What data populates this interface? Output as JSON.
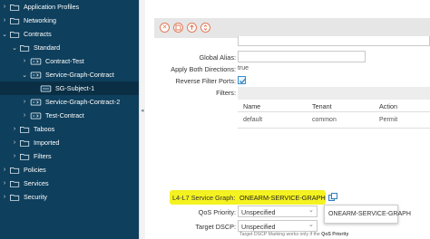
{
  "sidebar": {
    "items": [
      {
        "label": "Application Profiles",
        "type": "folder",
        "level": 0,
        "expanded": false
      },
      {
        "label": "Networking",
        "type": "folder",
        "level": 0,
        "expanded": false
      },
      {
        "label": "Contracts",
        "type": "folder",
        "level": 0,
        "expanded": true
      },
      {
        "label": "Standard",
        "type": "folder",
        "level": 1,
        "expanded": true
      },
      {
        "label": "Contract-Test",
        "type": "contract",
        "level": 2,
        "expanded": false
      },
      {
        "label": "Service-Graph-Contract",
        "type": "contract",
        "level": 2,
        "expanded": true
      },
      {
        "label": "SG-Subject-1",
        "type": "subject",
        "level": 3,
        "selected": true
      },
      {
        "label": "Service-Graph-Contract-2",
        "type": "contract",
        "level": 2,
        "expanded": false
      },
      {
        "label": "Test-Contract",
        "type": "contract",
        "level": 2,
        "expanded": false
      },
      {
        "label": "Taboos",
        "type": "folder",
        "level": 1,
        "expanded": false
      },
      {
        "label": "Imported",
        "type": "folder",
        "level": 1,
        "expanded": false
      },
      {
        "label": "Filters",
        "type": "folder",
        "level": 1,
        "expanded": false
      },
      {
        "label": "Policies",
        "type": "folder",
        "level": 0,
        "expanded": false
      },
      {
        "label": "Services",
        "type": "folder",
        "level": 0,
        "expanded": false
      },
      {
        "label": "Security",
        "type": "folder",
        "level": 0,
        "expanded": false
      }
    ]
  },
  "toolbar": {
    "icons": [
      "delete-icon",
      "save-icon",
      "upload-icon",
      "add-icon"
    ]
  },
  "form": {
    "global_alias_label": "Global Alias:",
    "global_alias_value": "",
    "apply_both_label": "Apply Both Directions:",
    "apply_both_value": "true",
    "reverse_filter_label": "Reverse Filter Ports:",
    "reverse_filter_checked": true,
    "filters_label": "Filters:"
  },
  "filters_table": {
    "columns": [
      "Name",
      "Tenant",
      "Action"
    ],
    "rows": [
      {
        "name": "default",
        "tenant": "common",
        "action": "Permit"
      }
    ]
  },
  "service_graph": {
    "label": "L4-L7 Service Graph:",
    "value": "ONEARM-SERVICE-GRAPH"
  },
  "qos": {
    "label": "QoS Priority:",
    "value": "Unspecified"
  },
  "dropdown": {
    "option": "ONEARM-SERVICE-GRAPH"
  },
  "target_dscp": {
    "label": "Target DSCP:",
    "value": "Unspecified",
    "help_prefix": "Target DSCP Marking works only if the",
    "help_bold": "QoS Priority"
  },
  "colors": {
    "sidebar_bg": "#0e3f5c",
    "highlight": "#f4f220",
    "toolbar_icon": "#e07b5a"
  }
}
